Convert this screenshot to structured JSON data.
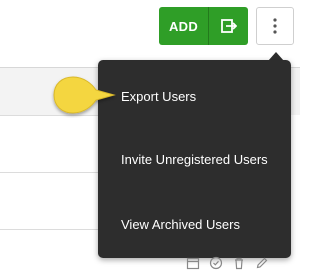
{
  "toolbar": {
    "add_label": "ADD",
    "export_icon": "export-icon",
    "more_icon": "kebab-vertical-icon",
    "accent": "#2f9e27"
  },
  "menu": {
    "items": [
      {
        "label": "Export Users"
      },
      {
        "label": "Invite Unregistered Users"
      },
      {
        "label": "View Archived Users"
      }
    ],
    "background": "#2d2d2d",
    "highlight": "callout pointer at Export Users"
  },
  "row_actions": {
    "icons": [
      "calendar-icon",
      "check-circle-icon",
      "trash-icon",
      "pencil-icon"
    ]
  }
}
